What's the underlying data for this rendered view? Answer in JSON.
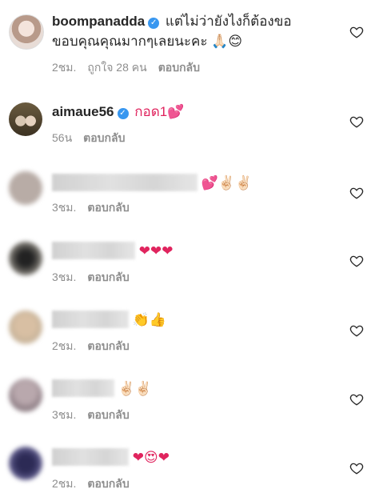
{
  "comments": [
    {
      "username": "boompanadda",
      "verified": true,
      "text_line1": "แต่ไม่ว่ายังไงก็ต้องขอ",
      "text_line2": "ขอบคุณคุณมากๆเลยนะคะ 🙏🏻😊",
      "time": "2ชม.",
      "likes": "ถูกใจ 28 คน",
      "reply": "ตอบกลับ"
    },
    {
      "username": "aimaue56",
      "verified": true,
      "text": "กอด1💕",
      "time": "56น",
      "reply": "ตอบกลับ"
    },
    {
      "username_hidden": true,
      "text": "💕✌🏻✌🏻",
      "time": "3ชม.",
      "reply": "ตอบกลับ"
    },
    {
      "username_hidden": true,
      "text": "❤❤❤",
      "time": "3ชม.",
      "reply": "ตอบกลับ"
    },
    {
      "username_hidden": true,
      "text": "👏👍",
      "time": "2ชม.",
      "reply": "ตอบกลับ"
    },
    {
      "username_hidden": true,
      "text": "✌🏻✌🏻",
      "time": "3ชม.",
      "reply": "ตอบกลับ"
    },
    {
      "username_hidden": true,
      "text": "❤😍❤",
      "time": "2ชม.",
      "reply": "ตอบกลับ"
    }
  ],
  "icons": {
    "like": "heart-outline-icon",
    "verified": "verified-badge-icon"
  },
  "colors": {
    "verified": "#3897f0",
    "meta": "#8e8e8e",
    "text": "#262626"
  }
}
